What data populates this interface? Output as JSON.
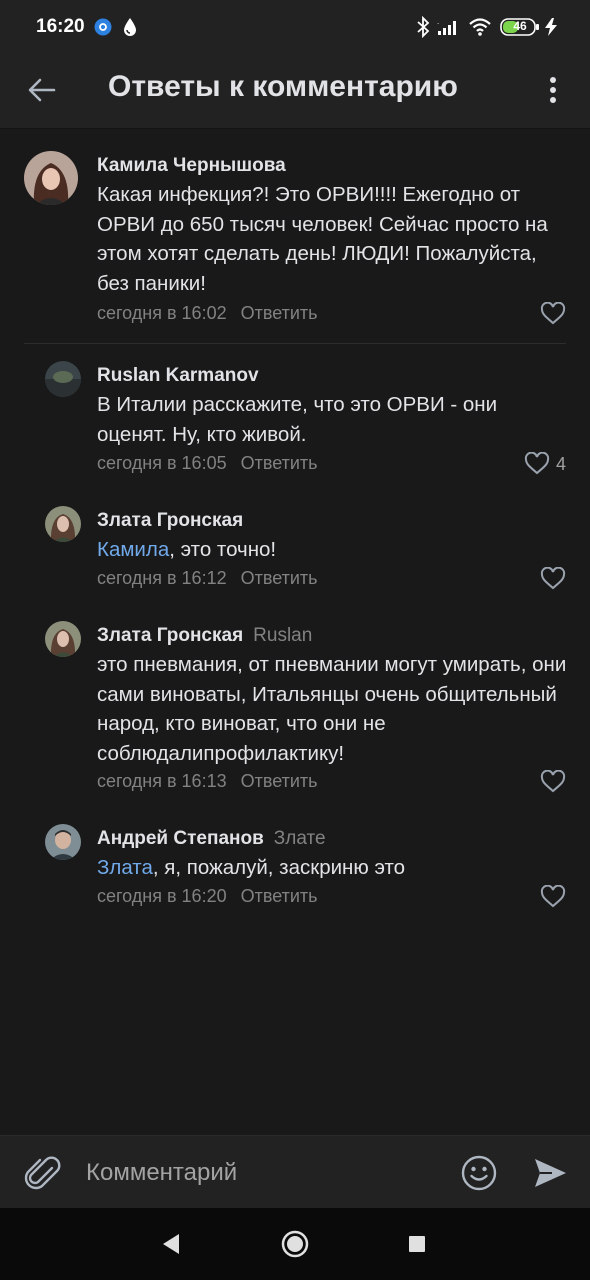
{
  "status_bar": {
    "time": "16:20",
    "battery": "46",
    "icons": [
      "vk-notification-icon",
      "water-drop-icon",
      "bluetooth-icon",
      "signal-icon",
      "wifi-icon",
      "battery-icon",
      "charging-icon"
    ]
  },
  "header": {
    "title": "Ответы к комментарию",
    "back_icon": "arrow-left-icon",
    "more_icon": "vertical-dots-icon"
  },
  "reply_label": "Ответить",
  "comments": [
    {
      "author": "Камила Чернышова",
      "reply_to": "",
      "mention": "",
      "text": "Какая инфекция?! Это ОРВИ!!!! Ежегодно от ОРВИ до 650 тысяч человек! Сейчас просто на этом хотят сделать день! ЛЮДИ! Пожалуйста, без паники!",
      "time": "сегодня в 16:02",
      "likes": ""
    },
    {
      "author": "Ruslan Karmanov",
      "reply_to": "",
      "mention": "",
      "text": "В Италии расскажите, что это ОРВИ - они оценят. Ну, кто живой.",
      "time": "сегодня в 16:05",
      "likes": "4"
    },
    {
      "author": "Злата Гронская",
      "reply_to": "",
      "mention": "Камила",
      "text": ", это точно!",
      "time": "сегодня в 16:12",
      "likes": ""
    },
    {
      "author": "Злата Гронская",
      "reply_to": "Ruslan",
      "mention": "",
      "text": "это пневмания, от пневмании могут умирать, они сами виноваты, Итальянцы очень общительный народ, кто виноват, что они не соблюдалипрофилактику!",
      "time": "сегодня в 16:13",
      "likes": ""
    },
    {
      "author": "Андрей Степанов",
      "reply_to": "Злате",
      "mention": "Злата",
      "text": ", я, пожалуй, заскриню это",
      "time": "сегодня в 16:20",
      "likes": ""
    }
  ],
  "composer": {
    "placeholder": "Комментарий",
    "attach_icon": "paperclip-icon",
    "emoji_icon": "smiley-icon",
    "send_icon": "send-arrow-icon"
  },
  "navbar": {
    "icons": [
      "back-triangle-icon",
      "home-circle-icon",
      "recents-square-icon"
    ]
  },
  "colors": {
    "background": "#19191a",
    "bar": "#222222",
    "text": "#e1e3e6",
    "secondary": "#828282",
    "mention": "#71aaeb"
  }
}
